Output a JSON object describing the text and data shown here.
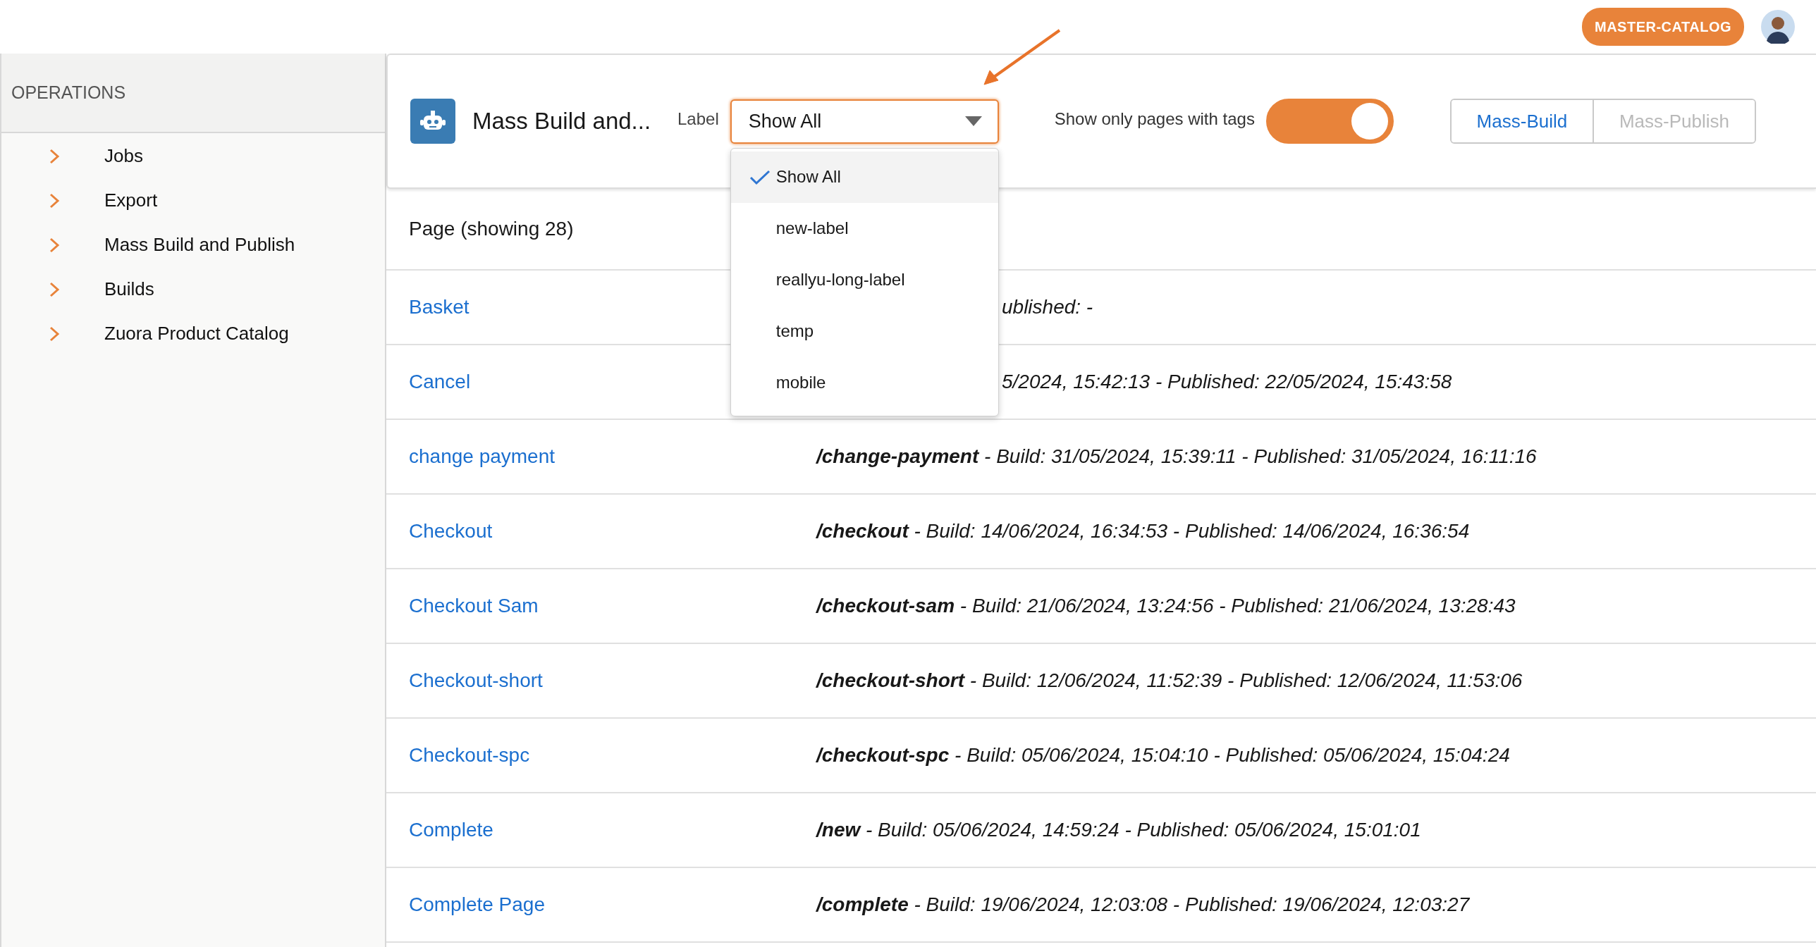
{
  "topbar": {
    "catalog_badge": "MASTER-CATALOG"
  },
  "sidebar": {
    "heading": "OPERATIONS",
    "items": [
      {
        "label": "Jobs"
      },
      {
        "label": "Export"
      },
      {
        "label": "Mass Build and Publish"
      },
      {
        "label": "Builds"
      },
      {
        "label": "Zuora Product Catalog"
      }
    ]
  },
  "header": {
    "title": "Mass Build and...",
    "label_caption": "Label",
    "label_select": {
      "value": "Show All",
      "expanded": true,
      "options": [
        {
          "label": "Show All",
          "selected": true
        },
        {
          "label": "new-label",
          "selected": false
        },
        {
          "label": "reallyu-long-label",
          "selected": false
        },
        {
          "label": "temp",
          "selected": false
        },
        {
          "label": "mobile",
          "selected": false
        }
      ]
    },
    "tags_toggle": {
      "label": "Show only pages with tags",
      "on": true
    },
    "buttons": [
      {
        "label": "Mass-Build",
        "disabled": false
      },
      {
        "label": "Mass-Publish",
        "disabled": true
      }
    ]
  },
  "pages": {
    "heading": "Page (showing 28)",
    "rows": [
      {
        "name": "Basket",
        "detail": "ublished: -",
        "kind": "partial"
      },
      {
        "name": "Cancel",
        "detail": "5/2024, 15:42:13 - Published: 22/05/2024, 15:43:58",
        "kind": "partial"
      },
      {
        "name": "change payment",
        "detail": "**/change-payment** - Build: 31/05/2024, 15:39:11 - Published: 31/05/2024, 16:11:16",
        "kind": "full"
      },
      {
        "name": "Checkout",
        "detail": "**/checkout** - Build: 14/06/2024, 16:34:53 - Published: 14/06/2024, 16:36:54",
        "kind": "full"
      },
      {
        "name": "Checkout Sam",
        "detail": "**/checkout-sam** - Build: 21/06/2024, 13:24:56 - Published: 21/06/2024, 13:28:43",
        "kind": "full"
      },
      {
        "name": "Checkout-short",
        "detail": "**/checkout-short** - Build: 12/06/2024, 11:52:39 - Published: 12/06/2024, 11:53:06",
        "kind": "full"
      },
      {
        "name": "Checkout-spc",
        "detail": "**/checkout-spc** - Build: 05/06/2024, 15:04:10 - Published: 05/06/2024, 15:04:24",
        "kind": "full"
      },
      {
        "name": "Complete",
        "detail": "**/new** - Build: 05/06/2024, 14:59:24 - Published: 05/06/2024, 15:01:01",
        "kind": "full"
      },
      {
        "name": "Complete Page",
        "detail": "**/complete** - Build: 19/06/2024, 12:03:08 - Published: 19/06/2024, 12:03:27",
        "kind": "full"
      }
    ]
  }
}
